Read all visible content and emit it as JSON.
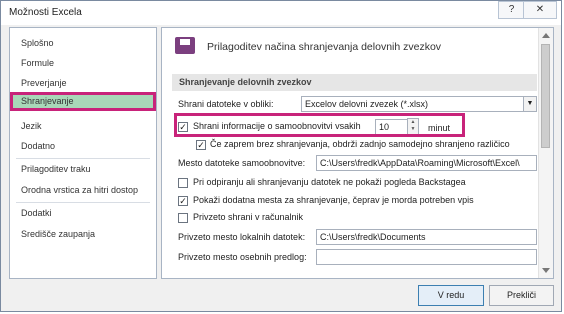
{
  "window": {
    "title": "Možnosti Excela",
    "help_glyph": "?",
    "close_glyph": "✕"
  },
  "sidebar": {
    "items": [
      {
        "label": "Splošno"
      },
      {
        "label": "Formule"
      },
      {
        "label": "Preverjanje"
      },
      {
        "label": "Shranjevanje"
      },
      {
        "label": "Jezik"
      },
      {
        "label": "Dodatno"
      },
      {
        "label": "Prilagoditev traku"
      },
      {
        "label": "Orodna vrstica za hitri dostop"
      },
      {
        "label": "Dodatki"
      },
      {
        "label": "Središče zaupanja"
      }
    ],
    "selected": "Shranjevanje"
  },
  "main": {
    "header_title": "Prilagoditev načina shranjevanja delovnih zvezkov",
    "section_title": "Shranjevanje delovnih zvezkov",
    "save_format": {
      "label": "Shrani datoteke v obliki:",
      "value": "Excelov delovni zvezek (*.xlsx)"
    },
    "autorecover": {
      "label": "Shrani informacije o samoobnovitvi vsakih",
      "minutes": "10",
      "unit": "minut",
      "checked": true
    },
    "keep_last": {
      "label": "Če zaprem brez shranjevanja, obdrži zadnjo samodejno shranjeno različico",
      "checked": true
    },
    "autorecover_location": {
      "label": "Mesto datoteke samoobnovitve:",
      "value": "C:\\Users\\fredk\\AppData\\Roaming\\Microsoft\\Excel\\"
    },
    "no_backstage": {
      "label": "Pri odpiranju ali shranjevanju datotek ne pokaži pogleda Backstagea",
      "checked": false
    },
    "show_places": {
      "label": "Pokaži dodatna mesta za shranjevanje, čeprav je morda potreben vpis",
      "checked": true
    },
    "save_local": {
      "label": "Privzeto shrani v računalnik",
      "checked": false
    },
    "local_location": {
      "label": "Privzeto mesto lokalnih datotek:",
      "value": "C:\\Users\\fredk\\Documents"
    },
    "personal_templates": {
      "label": "Privzeto mesto osebnih predlog:",
      "value": ""
    }
  },
  "buttons": {
    "ok": "V redu",
    "cancel": "Prekliči"
  },
  "colors": {
    "highlight": "#c8237a",
    "selected_bg": "#a8d8b8",
    "icon": "#7b3f7f"
  }
}
